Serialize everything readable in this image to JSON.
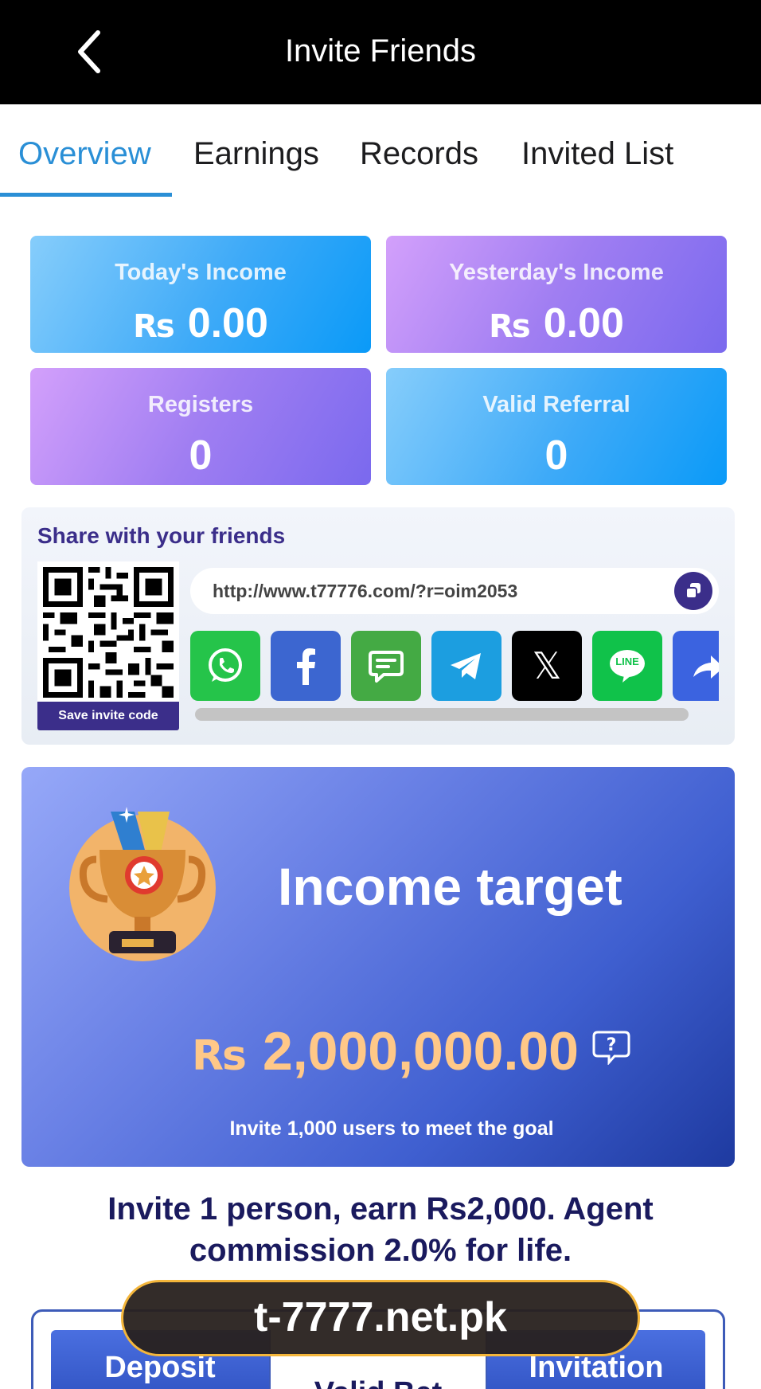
{
  "header": {
    "title": "Invite Friends"
  },
  "tabs": [
    {
      "label": "Overview",
      "active": true
    },
    {
      "label": "Earnings"
    },
    {
      "label": "Records"
    },
    {
      "label": "Invited List"
    }
  ],
  "stats": {
    "currency": "Rs",
    "today_income": {
      "label": "Today's Income",
      "value": "0.00"
    },
    "yesterday_income": {
      "label": "Yesterday's Income",
      "value": "0.00"
    },
    "registers": {
      "label": "Registers",
      "value": "0"
    },
    "valid_referral": {
      "label": "Valid Referral",
      "value": "0"
    }
  },
  "share": {
    "title": "Share with your friends",
    "link": "http://www.t77776.com/?r=oim2053",
    "save_label": "Save invite code",
    "line_label": "LINE",
    "x_label": "𝕏",
    "icons": [
      "whatsapp-icon",
      "facebook-icon",
      "message-icon",
      "telegram-icon",
      "x-icon",
      "line-icon",
      "share-icon"
    ]
  },
  "target": {
    "title": "Income target",
    "currency": "Rs",
    "amount": "2,000,000.00",
    "subtitle": "Invite 1,000 users to meet the goal"
  },
  "promo": "Invite 1 person, earn Rs2,000. Agent commission 2.0% for life.",
  "table": {
    "col1": "Deposit",
    "col2": "Valid Bet",
    "col3": "Invitation"
  },
  "watermark": "t-7777.net.pk",
  "colors": {
    "accent_tab": "#2a8fd6",
    "brand_purple": "#3b2e8a",
    "amount_gold": "#ffc888"
  }
}
